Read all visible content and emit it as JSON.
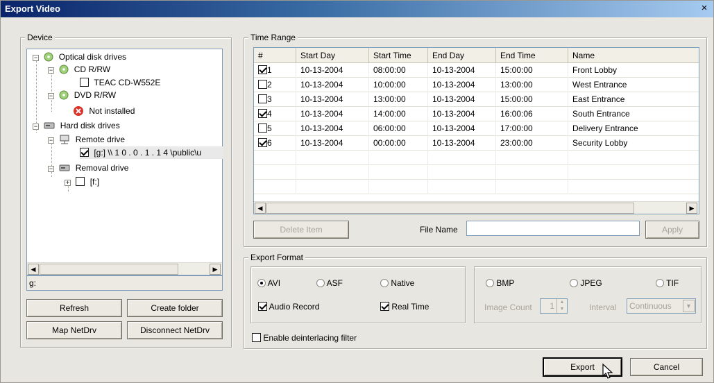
{
  "window": {
    "title": "Export Video",
    "close": "×"
  },
  "device": {
    "legend": "Device",
    "tree": {
      "optical": "Optical disk drives",
      "cdrw": "CD R/RW",
      "teac": "TEAC    CD-W552E",
      "dvdrw": "DVD R/RW",
      "not_installed": "Not installed",
      "hdd": "Hard disk drives",
      "remote": "Remote drive",
      "remote_path": "[g:] \\\\ 1 0 . 0 . 1 . 1 4  \\public\\u",
      "removal": "Removal drive",
      "removal_f": "[f:]"
    },
    "path_value": "g:",
    "buttons": {
      "refresh": "Refresh",
      "create_folder": "Create folder",
      "map": "Map NetDrv",
      "disconnect": "Disconnect NetDrv"
    }
  },
  "time_range": {
    "legend": "Time Range",
    "columns": [
      "#",
      "Start Day",
      "Start Time",
      "End Day",
      "End Time",
      "Name"
    ],
    "rows": [
      {
        "checked": true,
        "num": "1",
        "start_day": "10-13-2004",
        "start_time": "08:00:00",
        "end_day": "10-13-2004",
        "end_time": "15:00:00",
        "name": "Front Lobby"
      },
      {
        "checked": false,
        "num": "2",
        "start_day": "10-13-2004",
        "start_time": "10:00:00",
        "end_day": "10-13-2004",
        "end_time": "13:00:00",
        "name": "West Entrance"
      },
      {
        "checked": false,
        "num": "3",
        "start_day": "10-13-2004",
        "start_time": "13:00:00",
        "end_day": "10-13-2004",
        "end_time": "15:00:00",
        "name": "East Entrance"
      },
      {
        "checked": true,
        "num": "4",
        "start_day": "10-13-2004",
        "start_time": "14:00:00",
        "end_day": "10-13-2004",
        "end_time": "16:00:06",
        "name": "South Entrance"
      },
      {
        "checked": false,
        "num": "5",
        "start_day": "10-13-2004",
        "start_time": "06:00:00",
        "end_day": "10-13-2004",
        "end_time": "17:00:00",
        "name": "Delivery Entrance"
      },
      {
        "checked": true,
        "num": "6",
        "start_day": "10-13-2004",
        "start_time": "00:00:00",
        "end_day": "10-13-2004",
        "end_time": "23:00:00",
        "name": "Security Lobby"
      }
    ],
    "delete_label": "Delete Item",
    "file_name_label": "File Name",
    "file_name_value": "",
    "apply_label": "Apply"
  },
  "export_format": {
    "legend": "Export Format",
    "avi": "AVI",
    "asf": "ASF",
    "native": "Native",
    "audio_record": "Audio Record",
    "real_time": "Real Time",
    "bmp": "BMP",
    "jpeg": "JPEG",
    "tif": "TIF",
    "image_count_label": "Image Count",
    "image_count_value": "1",
    "interval_label": "Interval",
    "interval_value": "Continuous",
    "deinterlace": "Enable deinterlacing filter"
  },
  "actions": {
    "export": "Export",
    "cancel": "Cancel"
  }
}
